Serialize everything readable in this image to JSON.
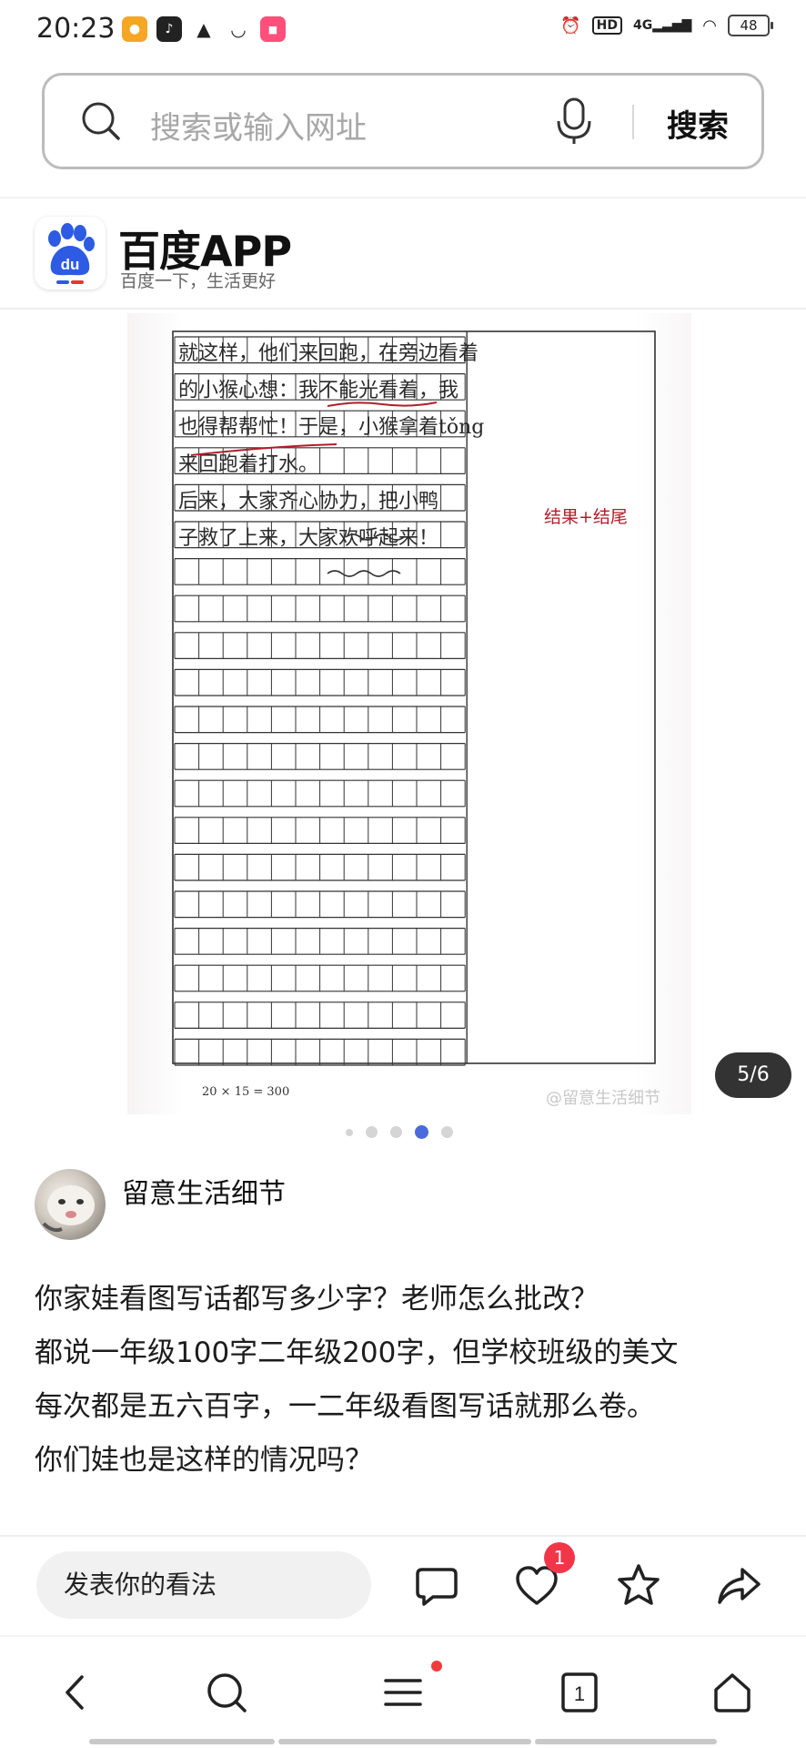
{
  "status_bar": {
    "time": "20:23",
    "network": "4G",
    "hd": "HD",
    "battery": "48"
  },
  "search": {
    "placeholder": "搜索或输入网址",
    "button_label": "搜索"
  },
  "banner": {
    "app_name": "百度APP",
    "slogan": "百度一下，生活更好",
    "logo_text": "du"
  },
  "gallery": {
    "paper_footer": "20 × 15 = 300",
    "watermark": "@留意生活细节",
    "page_counter": "5/6",
    "handwritten_lines": [
      "就这样，他们来回跑，在旁边看着",
      "的小猴心想：我不能光看着，我",
      "也得帮帮忙！于是，小猴拿着tǒng",
      "来回跑着打水。",
      "后来，大家齐心协力，把小鸭",
      "子救了上来，大家欢呼起来！"
    ],
    "annotations": [
      "结果+结尾"
    ],
    "dots_count": 5,
    "active_dot": 3
  },
  "author": {
    "name": "留意生活细节"
  },
  "post": {
    "lines": [
      "你家娃看图写话都写多少字？老师怎么批改？",
      "都说一年级100字二年级200字，但学校班级的美文",
      "每次都是五六百字，一二年级看图写话就那么卷。",
      "你们娃也是这样的情况吗？"
    ]
  },
  "actions": {
    "comment_placeholder": "发表你的看法",
    "like_badge": "1"
  },
  "bottom_nav": {
    "tabs_count": "1"
  },
  "colors": {
    "accent": "#4b6bdc",
    "badge": "#f2364a",
    "baidu_blue": "#2d5be3",
    "ink_red": "#b01e2a"
  }
}
